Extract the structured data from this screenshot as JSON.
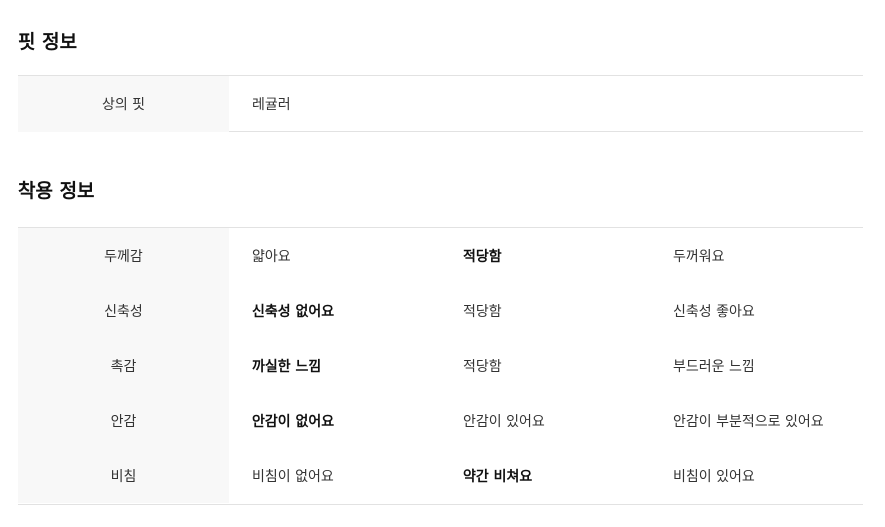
{
  "fit": {
    "title": "핏 정보",
    "label": "상의 핏",
    "value": "레귤러"
  },
  "wear": {
    "title": "착용 정보",
    "rows": [
      {
        "label": "두께감",
        "options": [
          "얇아요",
          "적당함",
          "두꺼워요"
        ],
        "selected": 1
      },
      {
        "label": "신축성",
        "options": [
          "신축성 없어요",
          "적당함",
          "신축성 좋아요"
        ],
        "selected": 0
      },
      {
        "label": "촉감",
        "options": [
          "까실한 느낌",
          "적당함",
          "부드러운 느낌"
        ],
        "selected": 0
      },
      {
        "label": "안감",
        "options": [
          "안감이 없어요",
          "안감이 있어요",
          "안감이 부분적으로 있어요"
        ],
        "selected": 0
      },
      {
        "label": "비침",
        "options": [
          "비침이 없어요",
          "약간 비쳐요",
          "비침이 있어요"
        ],
        "selected": 1
      }
    ]
  }
}
